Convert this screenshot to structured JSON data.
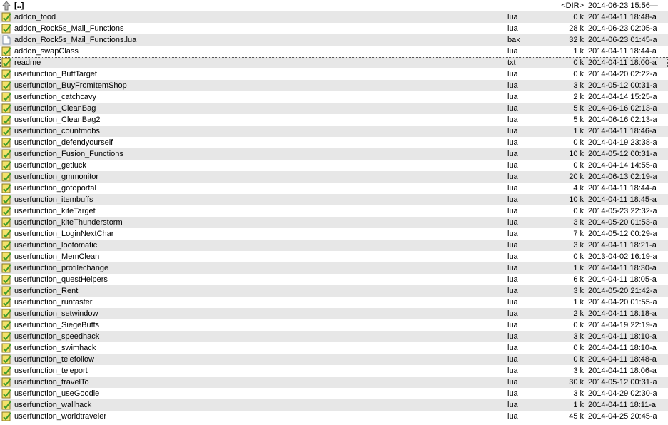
{
  "parent": {
    "name": "[..]",
    "size": "<DIR>",
    "date": "2014-06-23 15:56—"
  },
  "files": [
    {
      "name": "addon_food",
      "ext": "lua",
      "size": "0 k",
      "date": "2014-04-11 18:48-a",
      "icon": "lua-file-icon"
    },
    {
      "name": "addon_Rock5s_Mail_Functions",
      "ext": "lua",
      "size": "28 k",
      "date": "2014-06-23 02:05-a",
      "icon": "lua-file-icon"
    },
    {
      "name": "addon_Rock5s_Mail_Functions.lua",
      "ext": "bak",
      "size": "32 k",
      "date": "2014-06-23 01:45-a",
      "icon": "generic-file-icon"
    },
    {
      "name": "addon_swapClass",
      "ext": "lua",
      "size": "1 k",
      "date": "2014-04-11 18:44-a",
      "icon": "lua-file-icon"
    },
    {
      "name": "readme",
      "ext": "txt",
      "size": "0 k",
      "date": "2014-04-11 18:00-a",
      "icon": "text-file-icon"
    },
    {
      "name": "userfunction_BuffTarget",
      "ext": "lua",
      "size": "0 k",
      "date": "2014-04-20 02:22-a",
      "icon": "lua-file-icon"
    },
    {
      "name": "userfunction_BuyFromItemShop",
      "ext": "lua",
      "size": "3 k",
      "date": "2014-05-12 00:31-a",
      "icon": "lua-file-icon"
    },
    {
      "name": "userfunction_catchcavy",
      "ext": "lua",
      "size": "2 k",
      "date": "2014-04-14 15:25-a",
      "icon": "lua-file-icon"
    },
    {
      "name": "userfunction_CleanBag",
      "ext": "lua",
      "size": "5 k",
      "date": "2014-06-16 02:13-a",
      "icon": "lua-file-icon"
    },
    {
      "name": "userfunction_CleanBag2",
      "ext": "lua",
      "size": "5 k",
      "date": "2014-06-16 02:13-a",
      "icon": "lua-file-icon"
    },
    {
      "name": "userfunction_countmobs",
      "ext": "lua",
      "size": "1 k",
      "date": "2014-04-11 18:46-a",
      "icon": "lua-file-icon"
    },
    {
      "name": "userfunction_defendyourself",
      "ext": "lua",
      "size": "0 k",
      "date": "2014-04-19 23:38-a",
      "icon": "lua-file-icon"
    },
    {
      "name": "userfunction_Fusion_Functions",
      "ext": "lua",
      "size": "10 k",
      "date": "2014-05-12 00:31-a",
      "icon": "lua-file-icon"
    },
    {
      "name": "userfunction_getluck",
      "ext": "lua",
      "size": "0 k",
      "date": "2014-04-14 14:55-a",
      "icon": "lua-file-icon"
    },
    {
      "name": "userfunction_gmmonitor",
      "ext": "lua",
      "size": "20 k",
      "date": "2014-06-13 02:19-a",
      "icon": "lua-file-icon"
    },
    {
      "name": "userfunction_gotoportal",
      "ext": "lua",
      "size": "4 k",
      "date": "2014-04-11 18:44-a",
      "icon": "lua-file-icon"
    },
    {
      "name": "userfunction_itembuffs",
      "ext": "lua",
      "size": "10 k",
      "date": "2014-04-11 18:45-a",
      "icon": "lua-file-icon"
    },
    {
      "name": "userfunction_kiteTarget",
      "ext": "lua",
      "size": "0 k",
      "date": "2014-05-23 22:32-a",
      "icon": "lua-file-icon"
    },
    {
      "name": "userfunction_kiteThunderstorm",
      "ext": "lua",
      "size": "3 k",
      "date": "2014-05-20 01:53-a",
      "icon": "lua-file-icon"
    },
    {
      "name": "userfunction_LoginNextChar",
      "ext": "lua",
      "size": "7 k",
      "date": "2014-05-12 00:29-a",
      "icon": "lua-file-icon"
    },
    {
      "name": "userfunction_lootomatic",
      "ext": "lua",
      "size": "3 k",
      "date": "2014-04-11 18:21-a",
      "icon": "lua-file-icon"
    },
    {
      "name": "userfunction_MemClean",
      "ext": "lua",
      "size": "0 k",
      "date": "2013-04-02 16:19-a",
      "icon": "lua-file-icon"
    },
    {
      "name": "userfunction_profilechange",
      "ext": "lua",
      "size": "1 k",
      "date": "2014-04-11 18:30-a",
      "icon": "lua-file-icon"
    },
    {
      "name": "userfunction_questHelpers",
      "ext": "lua",
      "size": "6 k",
      "date": "2014-04-11 18:05-a",
      "icon": "lua-file-icon"
    },
    {
      "name": "userfunction_Rent",
      "ext": "lua",
      "size": "3 k",
      "date": "2014-05-20 21:42-a",
      "icon": "lua-file-icon"
    },
    {
      "name": "userfunction_runfaster",
      "ext": "lua",
      "size": "1 k",
      "date": "2014-04-20 01:55-a",
      "icon": "lua-file-icon"
    },
    {
      "name": "userfunction_setwindow",
      "ext": "lua",
      "size": "2 k",
      "date": "2014-04-11 18:18-a",
      "icon": "lua-file-icon"
    },
    {
      "name": "userfunction_SiegeBuffs",
      "ext": "lua",
      "size": "0 k",
      "date": "2014-04-19 22:19-a",
      "icon": "lua-file-icon"
    },
    {
      "name": "userfunction_speedhack",
      "ext": "lua",
      "size": "3 k",
      "date": "2014-04-11 18:10-a",
      "icon": "lua-file-icon"
    },
    {
      "name": "userfunction_swimhack",
      "ext": "lua",
      "size": "0 k",
      "date": "2014-04-11 18:10-a",
      "icon": "lua-file-icon"
    },
    {
      "name": "userfunction_telefollow",
      "ext": "lua",
      "size": "0 k",
      "date": "2014-04-11 18:48-a",
      "icon": "lua-file-icon"
    },
    {
      "name": "userfunction_teleport",
      "ext": "lua",
      "size": "3 k",
      "date": "2014-04-11 18:06-a",
      "icon": "lua-file-icon"
    },
    {
      "name": "userfunction_travelTo",
      "ext": "lua",
      "size": "30 k",
      "date": "2014-05-12 00:31-a",
      "icon": "lua-file-icon"
    },
    {
      "name": "userfunction_useGoodie",
      "ext": "lua",
      "size": "3 k",
      "date": "2014-04-29 02:30-a",
      "icon": "lua-file-icon"
    },
    {
      "name": "userfunction_wallhack",
      "ext": "lua",
      "size": "1 k",
      "date": "2014-04-11 18:11-a",
      "icon": "lua-file-icon"
    },
    {
      "name": "userfunction_worldtraveler",
      "ext": "lua",
      "size": "45 k",
      "date": "2014-04-25 20:45-a",
      "icon": "lua-file-icon"
    }
  ],
  "focused_index": 4,
  "colors": {
    "row_alt": "#e7e7e7",
    "lua_icon_yellow": "#f4e26a",
    "lua_icon_green": "#3f9b2a"
  }
}
